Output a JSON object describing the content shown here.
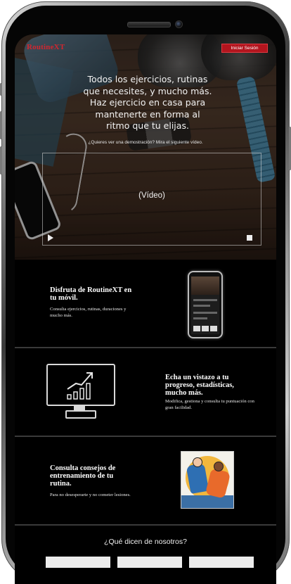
{
  "header": {
    "brand": "RoutineXT",
    "login_label": "Iniciar Sesión"
  },
  "hero": {
    "headline": "Todos los ejercicios, rutinas que necesites, y mucho más. Haz ejercicio en casa para mantenerte en forma al ritmo que tu elijas.",
    "demo_prompt": "¿Quieres ver una demostración? Mira el siguiente vídeo.",
    "video_label": "(Vídeo)"
  },
  "features": [
    {
      "title": "Disfruta de RoutineXT en tu móvil.",
      "text": "Consulta ejercicios, rutinas, duraciones y mucho más."
    },
    {
      "title": "Echa un vistazo a tu progreso, estadísticas, mucho más.",
      "text": "Modifica, gestiona y consulta tu puntuación con gran facilidad."
    },
    {
      "title": "Consulta consejos de entrenamiento de tu rutina.",
      "text": "Para no desesperarte y no cometer lesiones."
    }
  ],
  "testimonials": {
    "title": "¿Qué dicen de nosotros?"
  },
  "icons": [
    "play-icon",
    "stop-icon",
    "chart-icon"
  ],
  "colors": {
    "brand": "#d1262f",
    "login_bg": "#b3151e",
    "background": "#000000"
  }
}
